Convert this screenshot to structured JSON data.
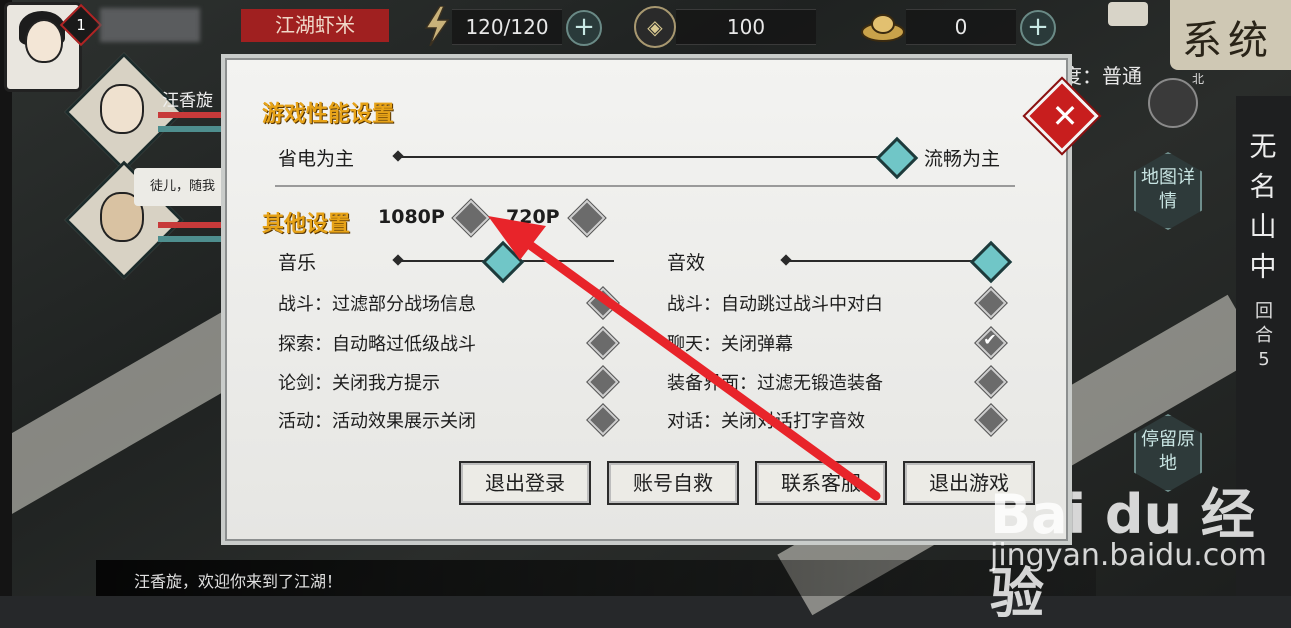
{
  "topbar": {
    "level": "1",
    "title_tag": "江湖虾米",
    "stamina": "120/120",
    "coins": "100",
    "ingots": "0",
    "system_label": "系统"
  },
  "party": {
    "member1_name": "汪香旋",
    "chat_bubble": "徒儿，随我"
  },
  "side": {
    "mode_label": "度：普通",
    "compass_north": "北",
    "location": "无名山中",
    "round_label": "回合5",
    "map_button": "地图详情",
    "stay_button": "停留原地"
  },
  "bottom": {
    "message": "汪香旋，欢迎你来到了江湖！"
  },
  "watermark": {
    "brand": "Bai  du 经验",
    "url": "jingyan.baidu.com"
  },
  "dialog": {
    "performance_title": "游戏性能设置",
    "power_saving_label": "省电为主",
    "smooth_label": "流畅为主",
    "performance_level": 1.0,
    "other_title": "其他设置",
    "res_1080": "1080P",
    "res_720": "720P",
    "music_label": "音乐",
    "music_level": 0.45,
    "sfx_label": "音效",
    "sfx_level": 1.0,
    "left_options": [
      {
        "label": "战斗：过滤部分战场信息",
        "checked": false
      },
      {
        "label": "探索：自动略过低级战斗",
        "checked": false
      },
      {
        "label": "论剑：关闭我方提示",
        "checked": false
      },
      {
        "label": "活动：活动效果展示关闭",
        "checked": false
      }
    ],
    "right_options": [
      {
        "label": "战斗：自动跳过战斗中对白",
        "checked": false
      },
      {
        "label": "聊天：关闭弹幕",
        "checked": true
      },
      {
        "label": "装备界面：过滤无锻造装备",
        "checked": false
      },
      {
        "label": "对话：关闭对话打字音效",
        "checked": false
      }
    ],
    "buttons": {
      "logout": "退出登录",
      "account_rescue": "账号自救",
      "contact_support": "联系客服",
      "exit_game": "退出游戏"
    },
    "check_glyph": "✔",
    "close_glyph": "✕"
  },
  "colors": {
    "accent_orange": "#e7a318",
    "knob_teal": "#70c6c7",
    "close_red": "#c81e1e",
    "annotation_arrow": "#e8242a"
  }
}
